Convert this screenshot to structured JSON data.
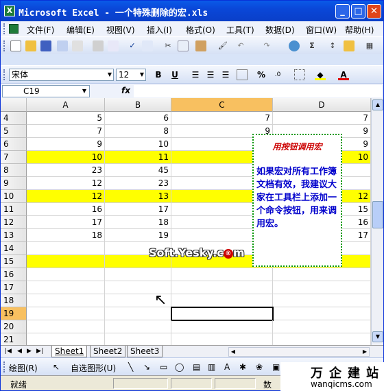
{
  "window": {
    "title": "Microsoft Excel - 一个特殊删除的宏.xls",
    "app_icon": "excel-icon",
    "buttons": [
      "minimize-icon",
      "maximize-icon",
      "close-icon"
    ]
  },
  "menubar": {
    "items": [
      "文件(F)",
      "编辑(E)",
      "视图(V)",
      "插入(I)",
      "格式(O)",
      "工具(T)",
      "数据(D)",
      "窗口(W)",
      "帮助(H)"
    ],
    "close": "×"
  },
  "toolbar_format": {
    "font": "宋体",
    "size": "12",
    "bold": "B",
    "underline": "U",
    "percent": "%"
  },
  "formula_bar": {
    "name_box": "C19",
    "fx": "fx",
    "content": ""
  },
  "columns": [
    "A",
    "B",
    "C",
    "D"
  ],
  "active_column": "C",
  "rows": [
    {
      "num": "4",
      "a": "5",
      "b": "6",
      "c": "7",
      "d": "7",
      "yellow": false
    },
    {
      "num": "5",
      "a": "7",
      "b": "8",
      "c": "9",
      "d": "9",
      "yellow": false
    },
    {
      "num": "6",
      "a": "9",
      "b": "10",
      "c": "",
      "d": "9",
      "yellow": false
    },
    {
      "num": "7",
      "a": "10",
      "b": "11",
      "c": "",
      "d": "10",
      "yellow": true
    },
    {
      "num": "8",
      "a": "23",
      "b": "45",
      "c": "",
      "d": "",
      "yellow": false
    },
    {
      "num": "9",
      "a": "12",
      "b": "23",
      "c": "",
      "d": "",
      "yellow": false
    },
    {
      "num": "10",
      "a": "12",
      "b": "13",
      "c": "",
      "d": "12",
      "yellow": true
    },
    {
      "num": "11",
      "a": "16",
      "b": "17",
      "c": "",
      "d": "15",
      "yellow": false
    },
    {
      "num": "12",
      "a": "17",
      "b": "18",
      "c": "",
      "d": "16",
      "yellow": false
    },
    {
      "num": "13",
      "a": "18",
      "b": "19",
      "c": "",
      "d": "17",
      "yellow": false
    },
    {
      "num": "14",
      "a": "",
      "b": "",
      "c": "",
      "d": "",
      "yellow": false
    },
    {
      "num": "15",
      "a": "",
      "b": "",
      "c": "",
      "d": "",
      "yellow": true
    },
    {
      "num": "16",
      "a": "",
      "b": "",
      "c": "",
      "d": "",
      "yellow": false
    },
    {
      "num": "17",
      "a": "",
      "b": "",
      "c": "",
      "d": "",
      "yellow": false
    },
    {
      "num": "18",
      "a": "",
      "b": "",
      "c": "",
      "d": "",
      "yellow": false
    },
    {
      "num": "19",
      "a": "",
      "b": "",
      "c": "",
      "d": "",
      "yellow": false
    },
    {
      "num": "20",
      "a": "",
      "b": "",
      "c": "",
      "d": "",
      "yellow": false
    },
    {
      "num": "21",
      "a": "",
      "b": "",
      "c": "",
      "d": "",
      "yellow": false
    }
  ],
  "active_row": "19",
  "callout": {
    "title": "用按钮调用宏",
    "body": "如果宏对所有工作簿文档有效，我建议大家在工具栏上添加一个命令按钮，用来调用宏。"
  },
  "watermark": "Soft.Yesky.c",
  "watermark_mark": "®",
  "watermark_tail": "m",
  "sheets": [
    "Sheet1",
    "Sheet2",
    "Sheet3"
  ],
  "active_sheet": "Sheet1",
  "drawbar": {
    "draw": "绘图(R)",
    "autoshapes": "自选图形(U)"
  },
  "status": {
    "ready": "就绪",
    "mode": "数"
  },
  "brand": {
    "name": "万企建站",
    "url": "wanqicms.com"
  },
  "colors": {
    "highlight": "#ffff00",
    "callout_border": "#009900",
    "callout_title": "#cc0000",
    "callout_body": "#0000cc",
    "active_header": "#f8c060"
  }
}
